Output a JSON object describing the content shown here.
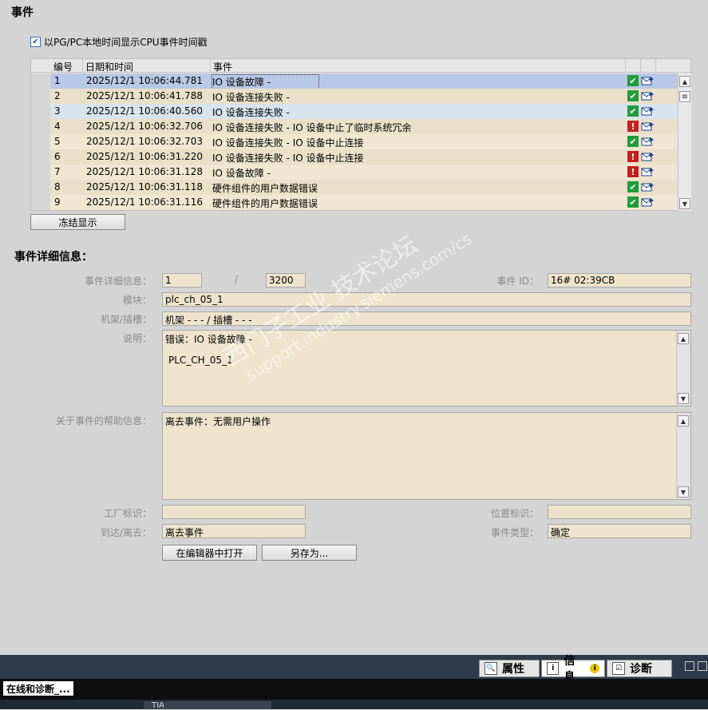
{
  "section_title": "事件",
  "checkbox_label": "以PG/PC本地时间显示CPU事件时间戳",
  "table": {
    "headers": [
      "编号",
      "日期和时间",
      "事件"
    ],
    "rows": [
      {
        "no": "1",
        "datetime": "2025/12/1 10:06:44.781",
        "event": "IO 设备故障 -",
        "status": "ok"
      },
      {
        "no": "2",
        "datetime": "2025/12/1 10:06:41.788",
        "event": "IO 设备连接失败 -",
        "status": "ok"
      },
      {
        "no": "3",
        "datetime": "2025/12/1 10:06:40.560",
        "event": "IO 设备连接失败 -",
        "status": "ok"
      },
      {
        "no": "4",
        "datetime": "2025/12/1 10:06:32.706",
        "event": "IO 设备连接失败 - IO 设备中止了临时系统冗余",
        "status": "error"
      },
      {
        "no": "5",
        "datetime": "2025/12/1 10:06:32.703",
        "event": "IO 设备连接失败 - IO 设备中止连接",
        "status": "ok"
      },
      {
        "no": "6",
        "datetime": "2025/12/1 10:06:31.220",
        "event": "IO 设备连接失败 - IO 设备中止连接",
        "status": "error"
      },
      {
        "no": "7",
        "datetime": "2025/12/1 10:06:31.128",
        "event": "IO 设备故障 -",
        "status": "error"
      },
      {
        "no": "8",
        "datetime": "2025/12/1 10:06:31.118",
        "event": "硬件组件的用户数据错误",
        "status": "ok"
      },
      {
        "no": "9",
        "datetime": "2025/12/1 10:06:31.116",
        "event": "硬件组件的用户数据错误",
        "status": "ok"
      }
    ]
  },
  "freeze_button": "冻结显示",
  "details": {
    "title": "事件详细信息：",
    "labels": {
      "detail": "事件详细信息：",
      "module": "模块：",
      "rack_slot": "机架/插槽：",
      "description": "说明：",
      "help": "关于事件的帮助信息：",
      "plant": "工厂标识：",
      "coming_going": "到达/离去：",
      "event_id": "事件 ID：",
      "location": "位置标识：",
      "event_type": "事件类型："
    },
    "detail_index": "1",
    "detail_separator": "/",
    "detail_total": "3200",
    "event_id": "16# 02:39CB",
    "module": "plc_ch_05_1",
    "rack_slot": "机架 - - - / 插槽 - - -",
    "description_line1": "错误：IO 设备故障 -",
    "description_line2": "PLC_CH_05_1",
    "help_text": "离去事件：无需用户操作",
    "plant_id": "",
    "location_id": "",
    "coming_going": "离去事件",
    "event_type": "确定"
  },
  "buttons": {
    "open_in_editor": "在编辑器中打开",
    "save_as": "另存为..."
  },
  "watermark": {
    "line1": "西门子工业  技术论坛",
    "line2": "support.industry.siemens.com/cs"
  },
  "bottom_tabs": [
    "属性",
    "信息",
    "诊断"
  ],
  "taskbar": {
    "item": "在线和诊断_...",
    "strip": "TIA"
  },
  "colors": {
    "field_bg": "#efe3cd",
    "status_ok": "#1f9d3a",
    "status_error": "#c81e1e",
    "selected_row": "#b9c8e4"
  }
}
